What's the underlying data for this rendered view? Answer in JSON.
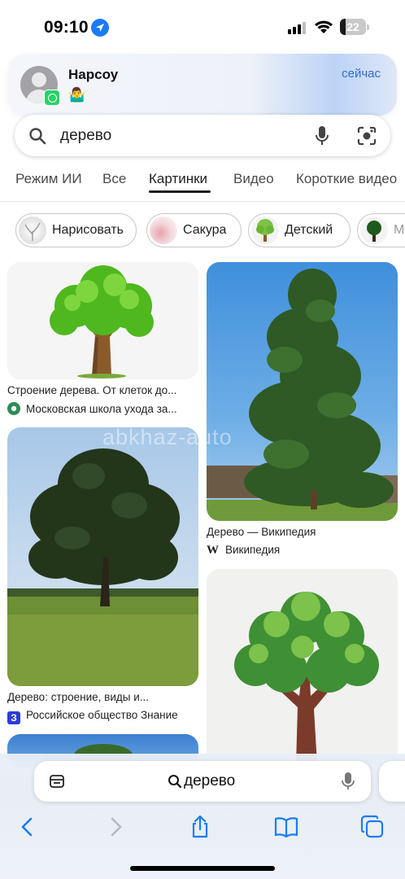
{
  "status_bar": {
    "time": "09:10",
    "battery": "22",
    "battery_level": 0.22
  },
  "notification": {
    "app_icon": "whatsapp-icon",
    "sender": "Нарсоу",
    "message": "🤷‍♂️",
    "time": "сейчас"
  },
  "search": {
    "query": "дерево"
  },
  "tabs": [
    {
      "label": "Режим ИИ"
    },
    {
      "label": "Все"
    },
    {
      "label": "Картинки",
      "active": true
    },
    {
      "label": "Видео"
    },
    {
      "label": "Короткие видео"
    }
  ],
  "chips": [
    {
      "label": "Нарисовать"
    },
    {
      "label": "Сакура"
    },
    {
      "label": "Детский"
    },
    {
      "label": "М"
    }
  ],
  "results": [
    {
      "title": "Строение дерева. От клеток до...",
      "source": "Московская школа ухода за..."
    },
    {
      "title": "Дерево — Википедия",
      "source": "Википедия",
      "source_icon_text": "W"
    },
    {
      "title": "Дерево: строение, виды и...",
      "source": "Российское общество Знание",
      "source_icon_text": "З"
    }
  ],
  "watermark": "abkhaz-auto",
  "bottom_bar": {
    "url_text": "дерево"
  },
  "colors": {
    "accent": "#1a7cf5",
    "notification_time": "#2f6bd1",
    "whatsapp": "#25d366"
  }
}
